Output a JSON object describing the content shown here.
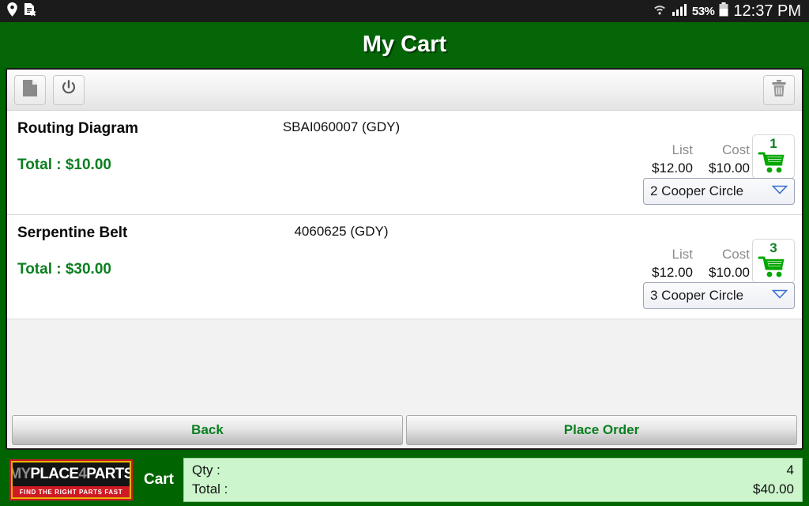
{
  "statusbar": {
    "icons": [
      "location-pin-icon",
      "sim-card-error-icon",
      "wifi-icon",
      "signal-bars-icon"
    ],
    "battery_text": "53%",
    "clock": "12:37 PM"
  },
  "header": {
    "title": "My Cart"
  },
  "toolbar": {
    "buttons": [
      {
        "name": "note-button",
        "icon": "document-icon"
      },
      {
        "name": "power-button",
        "icon": "power-icon"
      },
      {
        "name": "delete-button",
        "icon": "trash-icon"
      }
    ]
  },
  "cart": {
    "items": [
      {
        "name": "Routing Diagram",
        "total_label": "Total : $10.00",
        "part_number": "SBAI060007 (GDY)",
        "list_label": "List",
        "cost_label": "Cost",
        "list_price": "$12.00",
        "cost_price": "$10.00",
        "quantity": "1",
        "location": "2 Cooper Circle"
      },
      {
        "name": "Serpentine Belt",
        "total_label": "Total : $30.00",
        "part_number": "4060625 (GDY)",
        "list_label": "List",
        "cost_label": "Cost",
        "list_price": "$12.00",
        "cost_price": "$10.00",
        "quantity": "3",
        "location": "3 Cooper Circle"
      }
    ]
  },
  "actions": {
    "back_label": "Back",
    "place_order_label": "Place Order"
  },
  "footer": {
    "logo": {
      "my": "MY",
      "place": "PLACE",
      "four": "4",
      "parts": "PARTS",
      "tagline": "FIND THE RIGHT PARTS FAST"
    },
    "cart_label": "Cart",
    "qty_label": "Qty :",
    "qty_value": "4",
    "total_label": "Total :",
    "total_value": "$40.00"
  },
  "colors": {
    "brand_green": "#006400",
    "header_green": "#056608",
    "accent_green": "#0a7f20",
    "summary_bg": "#ccf5cc",
    "logo_red": "#cf1a23",
    "logo_gold": "#e8b007"
  }
}
